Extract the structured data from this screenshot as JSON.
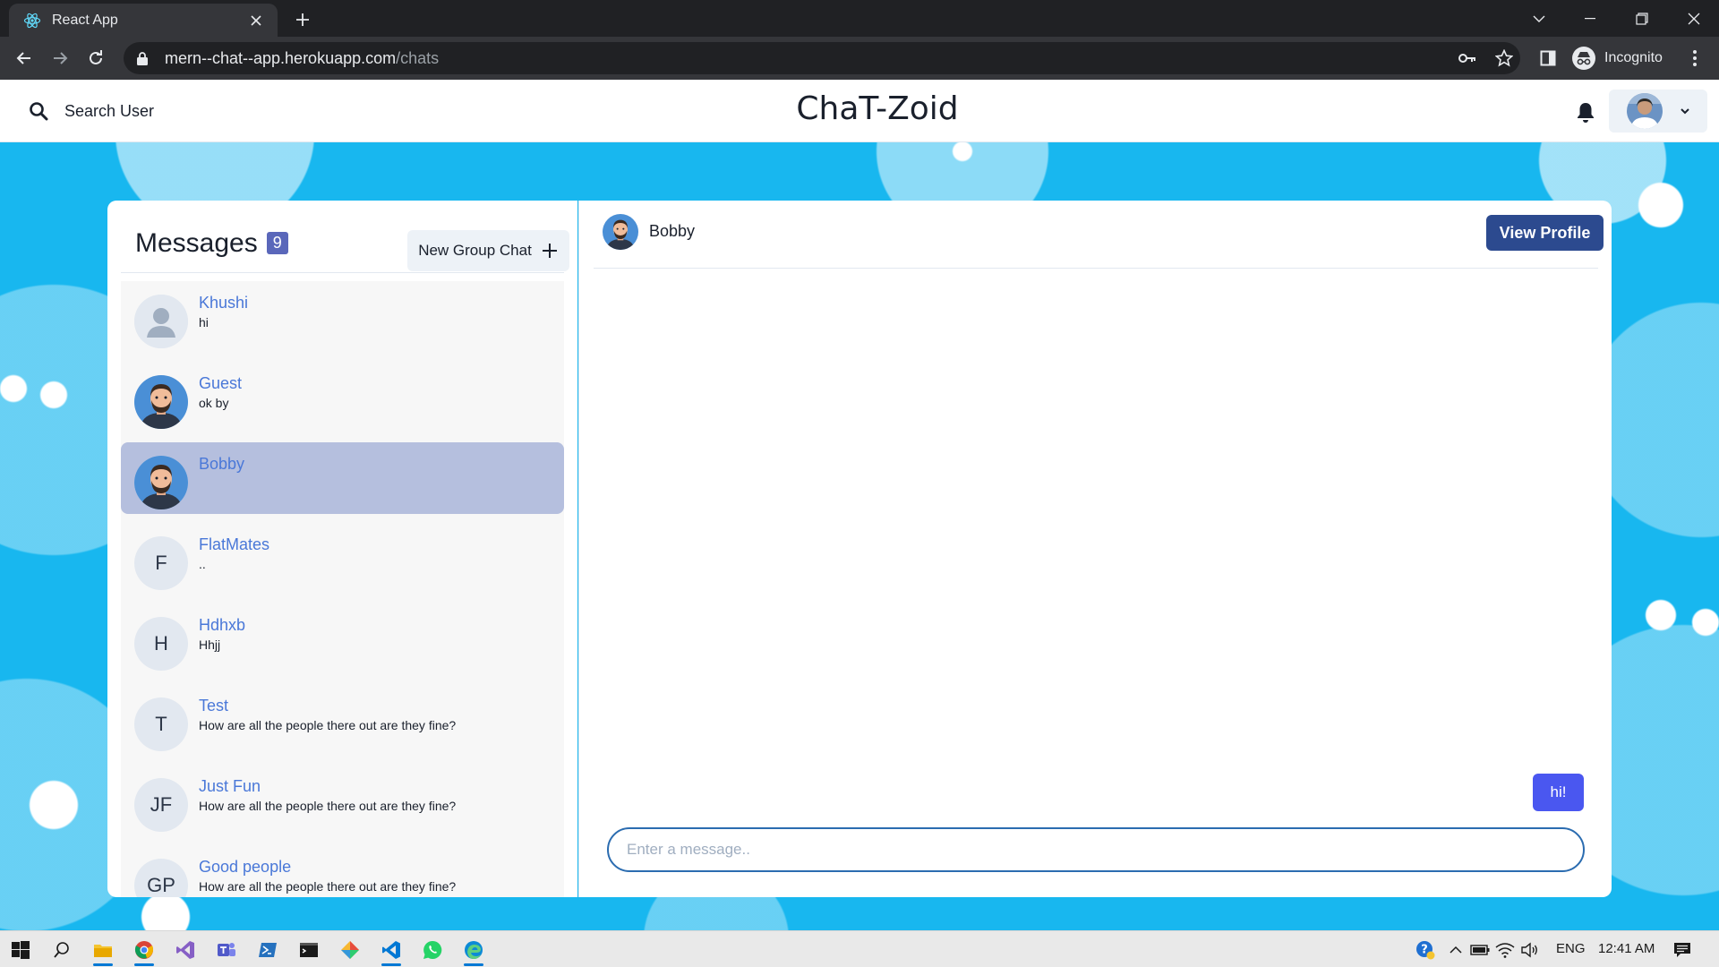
{
  "browser": {
    "tab_title": "React App",
    "url_host": "mern--chat--app.herokuapp.com",
    "url_path": "/chats",
    "incognito_label": "Incognito"
  },
  "header": {
    "search_label": "Search User",
    "brand": "ChaT-Zoid"
  },
  "sidebar": {
    "title": "Messages",
    "count": "9",
    "new_group_label": "New Group Chat",
    "chats": [
      {
        "name": "Khushi",
        "last": "hi",
        "avatar": "default"
      },
      {
        "name": "Guest",
        "last": "ok by",
        "avatar": "photo"
      },
      {
        "name": "Bobby",
        "last": "",
        "avatar": "photo",
        "active": true
      },
      {
        "name": "FlatMates",
        "last": "..",
        "avatar": "initials",
        "initials": "F"
      },
      {
        "name": "Hdhxb",
        "last": "Hhjj",
        "avatar": "initials",
        "initials": "H"
      },
      {
        "name": "Test",
        "last": "How are all the people there out are they fine?",
        "avatar": "initials",
        "initials": "T"
      },
      {
        "name": "Just Fun",
        "last": "How are all the people there out are they fine?",
        "avatar": "initials",
        "initials": "JF"
      },
      {
        "name": "Good people",
        "last": "How are all the people there out are they fine?",
        "avatar": "initials",
        "initials": "GP"
      }
    ]
  },
  "conversation": {
    "name": "Bobby",
    "view_profile_label": "View Profile",
    "messages": [
      {
        "text": "hi!",
        "own": true
      }
    ],
    "input_placeholder": "Enter a message.."
  },
  "taskbar": {
    "language": "ENG",
    "time": "12:41 AM"
  },
  "colors": {
    "background": "#18b7ef",
    "accent": "#2c4a8f",
    "active_chat": "#b5bfde",
    "bubble": "#4a57f0",
    "chat_name": "#4a78d8"
  }
}
